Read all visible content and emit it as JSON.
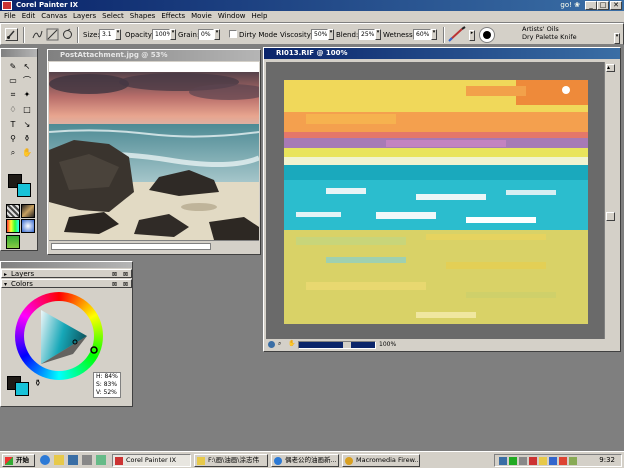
{
  "app": {
    "title": "Corel Painter IX",
    "title_extras": "go! ❀",
    "controls": [
      "_",
      "□",
      "✕"
    ]
  },
  "menu": [
    "File",
    "Edit",
    "Canvas",
    "Layers",
    "Select",
    "Shapes",
    "Effects",
    "Movie",
    "Window",
    "Help"
  ],
  "propbar": {
    "size_label": "Size:",
    "size_value": "3.1",
    "opacity_label": "Opacity:",
    "opacity_value": "100%",
    "grain_label": "Grain:",
    "grain_value": "0%",
    "dirty_mode_label": "Dirty Mode",
    "viscosity_label": "Viscosity:",
    "viscosity_value": "50%",
    "blend_label": "Blend:",
    "blend_value": "25%",
    "wetness_label": "Wetness:",
    "wetness_value": "60%",
    "brush_category": "Artists' Oils",
    "brush_variant": "Dry Palette Knife"
  },
  "documents": {
    "photo": {
      "title": "PostAttachment.jpg @ 53%"
    },
    "painting": {
      "title": "RI013.RIF @ 100%",
      "zoom": "100%"
    }
  },
  "palettes": {
    "layers_title": "Layers",
    "colors_title": "Colors",
    "hsv": {
      "h": "H: 84%",
      "s": "S: 83%",
      "v": "V: 52%"
    }
  },
  "taskbar": {
    "start": "开始",
    "buttons": [
      "Corel Painter IX",
      "F:\\画\\油画\\涂志伟",
      "偶老公的油画新...",
      "Macromedia Firew..."
    ],
    "clock": "9:32"
  },
  "colors": {
    "main_color": "#1e1a16",
    "additional_color": "#17c2d8",
    "titlebar_active": "#0a246a"
  }
}
